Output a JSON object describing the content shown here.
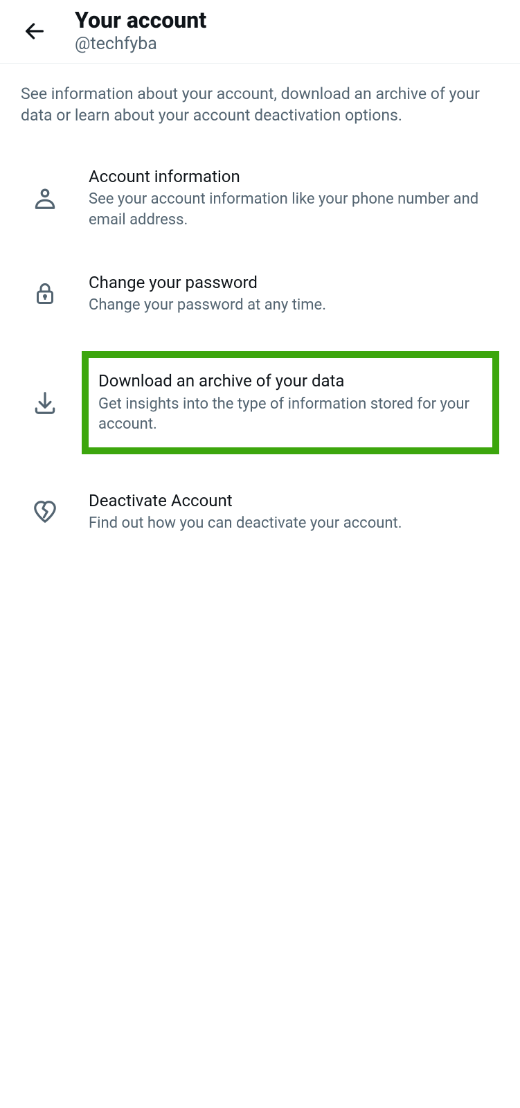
{
  "header": {
    "title": "Your account",
    "handle": "@techfyba"
  },
  "description": "See information about your account, download an archive of your data or learn about your account deactivation options.",
  "menu": [
    {
      "title": "Account information",
      "desc": "See your account information like your phone number and email address."
    },
    {
      "title": "Change your password",
      "desc": "Change your password at any time."
    },
    {
      "title": "Download an archive of your data",
      "desc": "Get insights into the type of information stored for your account."
    },
    {
      "title": "Deactivate Account",
      "desc": "Find out how you can deactivate your account."
    }
  ]
}
